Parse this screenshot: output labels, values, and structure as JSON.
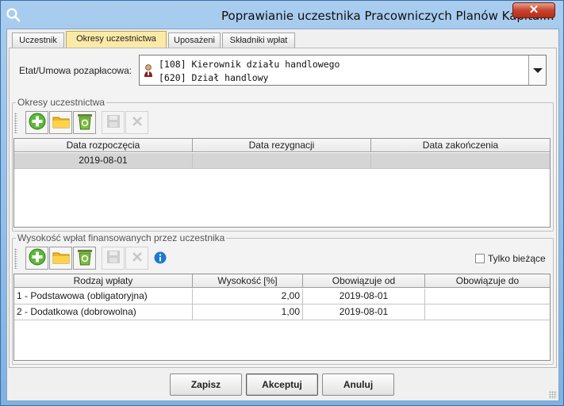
{
  "window": {
    "title": "Poprawianie uczestnika Pracowniczych Planów Kapitał...",
    "close_label": "✕"
  },
  "tabs": [
    {
      "label": "Uczestnik",
      "active": false
    },
    {
      "label": "Okresy uczestnictwa",
      "active": true
    },
    {
      "label": "Uposażeni",
      "active": false
    },
    {
      "label": "Składniki wpłat",
      "active": false
    }
  ],
  "etat": {
    "label": "Etat/Umowa pozapłacowa:",
    "line1": "[108] Kierownik działu handlowego",
    "line2": "[620] Dział handlowy"
  },
  "okresy": {
    "title": "Okresy uczestnictwa",
    "columns": [
      "Data rozpoczęcia",
      "Data rezygnacji",
      "Data zakończenia"
    ],
    "rows": [
      {
        "start": "2019-08-01",
        "resign": "",
        "end": ""
      }
    ]
  },
  "wplaty": {
    "title": "Wysokość wpłat finansowanych przez uczestnika",
    "only_current_label": "Tylko bieżące",
    "only_current_checked": false,
    "columns": [
      "Rodzaj wpłaty",
      "Wysokość [%]",
      "Obowiązuje od",
      "Obowiązuje do"
    ],
    "rows": [
      {
        "type": "1 - Podstawowa (obligatoryjna)",
        "amount": "2,00",
        "from": "2019-08-01",
        "to": ""
      },
      {
        "type": "2 - Dodatkowa (dobrowolna)",
        "amount": "1,00",
        "from": "2019-08-01",
        "to": ""
      }
    ]
  },
  "buttons": {
    "save": "Zapisz",
    "accept": "Akceptuj",
    "cancel": "Anuluj"
  },
  "icons": {
    "add": "add-icon",
    "open": "folder-icon",
    "delete": "recycle-bin-icon",
    "save": "disk-icon",
    "remove": "x-icon",
    "info": "info-icon"
  },
  "colors": {
    "active_tab": "#fbeaa7",
    "selected_row": "#d5d5d5",
    "title_bar": "#a9cdef",
    "close_button": "#c8432c"
  }
}
